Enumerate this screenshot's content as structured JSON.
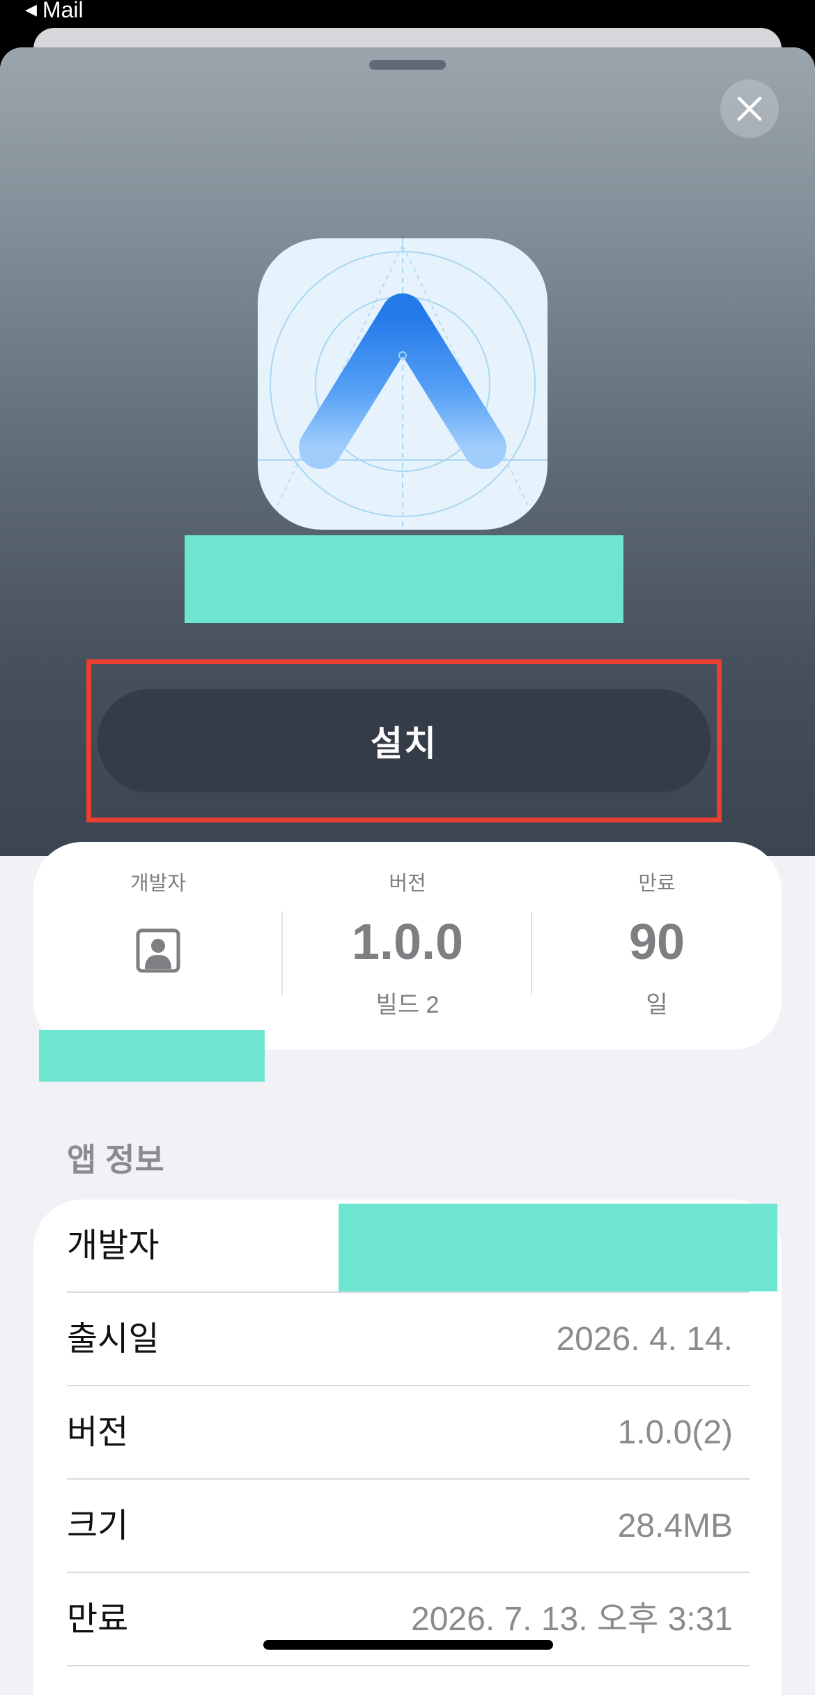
{
  "status_bar": {
    "back_label": "Mail",
    "back_icon": "back-triangle-icon"
  },
  "hero": {
    "close_icon": "close-icon",
    "install_label": "설치",
    "colors": {
      "highlight": "#ea3f33",
      "redaction": "#6de5d0",
      "button": "#333c47"
    }
  },
  "stats": {
    "developer_label": "개발자",
    "version_label": "버전",
    "version_value": "1.0.0",
    "build_label": "빌드 2",
    "expiry_label": "만료",
    "expiry_value": "90",
    "expiry_unit": "일"
  },
  "app_info": {
    "section_title": "앱 정보",
    "rows": [
      {
        "key": "개발자",
        "value": ""
      },
      {
        "key": "출시일",
        "value": "2026. 4. 14."
      },
      {
        "key": "버전",
        "value": "1.0.0(2)"
      },
      {
        "key": "크기",
        "value": "28.4MB"
      },
      {
        "key": "만료",
        "value": "2026. 7. 13. 오후 3:31"
      }
    ]
  }
}
